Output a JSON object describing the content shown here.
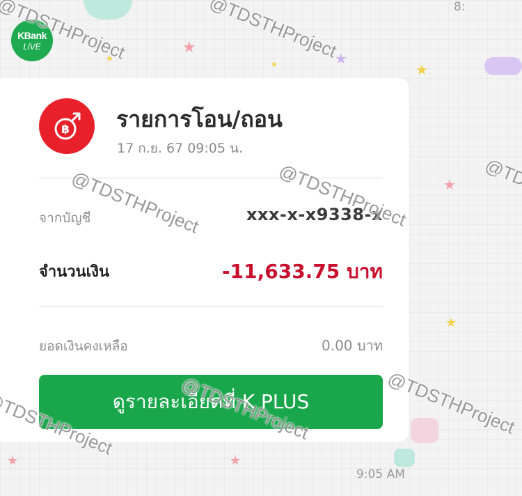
{
  "app": {
    "badge_line1": "KBank",
    "badge_line2": "LiVE"
  },
  "card": {
    "title": "รายการโอน/ถอน",
    "datetime": "17 ก.ย. 67 09:05 น.",
    "from_account_label": "จากบัญชี",
    "from_account_value": "xxx-x-x9338-x",
    "amount_label": "จำนวนเงิน",
    "amount_value": "-11,633.75 บาท",
    "balance_label": "ยอดเงินคงเหลือ",
    "balance_value": "0.00 บาท",
    "cta_label": "ดูรายละเอียดที่ K PLUS"
  },
  "chat": {
    "message_time": "9:05 AM",
    "top_time": "8:"
  },
  "watermark": {
    "text": "@TDSTHProject"
  },
  "colors": {
    "kbank_green": "#1aa64b",
    "icon_red": "#e8202a",
    "amount_red": "#c8102e"
  },
  "icons": {
    "transfer_icon": "baht-transfer-icon"
  }
}
